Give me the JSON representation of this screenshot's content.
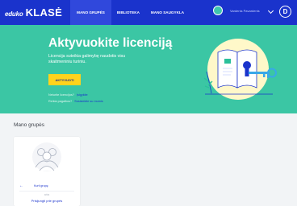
{
  "header": {
    "logo_sub": "eduko",
    "logo_main": "KLASĖ",
    "tabs": [
      {
        "label": "MANO GRUPĖS",
        "active": true
      },
      {
        "label": "BIBLIOTEKA",
        "active": false
      },
      {
        "label": "MANO SAUGYKLA",
        "active": false
      }
    ],
    "user_name": "Vardenis Pavardenis",
    "brand_color": "#1a33cc"
  },
  "hero": {
    "title": "Aktyvuokite licenciją",
    "subtitle": "Licencija suteikia galimybę naudotis visu skaitmeniniu turiniu.",
    "activate_label": "AKTYVUOTI",
    "row1_label": "Neturite licencijos?",
    "row1_link": "Įsigykite",
    "row2_label": "Reikia pagalbos?",
    "row2_link": "Susisiekite su mumis",
    "bg_color": "#3bc6a4",
    "button_color": "#ffd31d"
  },
  "groups": {
    "heading": "Mano grupės",
    "cards": [
      {
        "link": "Kurti grupę",
        "small": "arba",
        "link2": "Prisijungti prie grupės"
      }
    ]
  }
}
